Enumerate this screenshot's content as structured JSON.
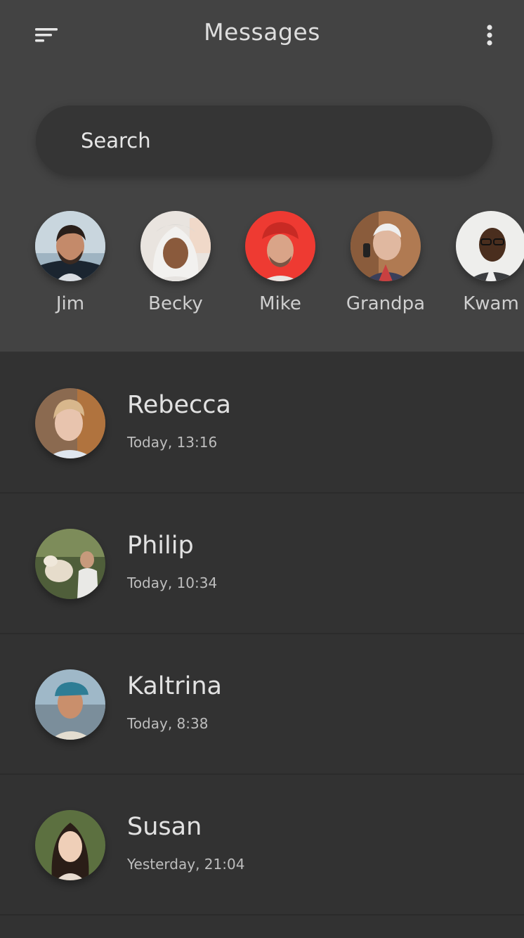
{
  "header": {
    "title": "Messages",
    "menu_icon": "sort-menu-icon",
    "more_icon": "more-vertical-icon"
  },
  "search": {
    "placeholder": "Search"
  },
  "stories": [
    {
      "name": "Jim"
    },
    {
      "name": "Becky"
    },
    {
      "name": "Mike"
    },
    {
      "name": "Grandpa"
    },
    {
      "name": "Kwam"
    }
  ],
  "conversations": [
    {
      "name": "Rebecca",
      "time": "Today, 13:16"
    },
    {
      "name": "Philip",
      "time": "Today, 10:34"
    },
    {
      "name": "Kaltrina",
      "time": "Today, 8:38"
    },
    {
      "name": "Susan",
      "time": "Yesterday, 21:04"
    }
  ],
  "colors": {
    "top_background": "#434343",
    "list_background": "#323232",
    "search_background": "#353535",
    "text": "#e0e0e0"
  }
}
